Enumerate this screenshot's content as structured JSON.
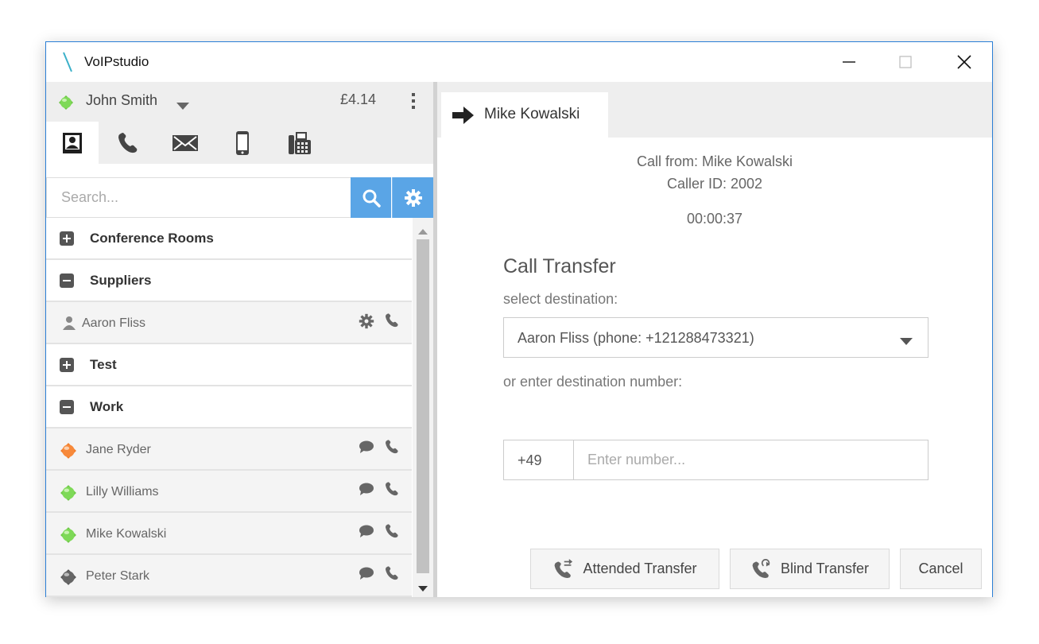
{
  "window": {
    "title": "VoIPstudio"
  },
  "account": {
    "name": "John Smith",
    "status": "online",
    "balance": "£4.14"
  },
  "search": {
    "placeholder": "Search..."
  },
  "contacts": {
    "groups": [
      {
        "label": "Conference Rooms",
        "expanded": false
      },
      {
        "label": "Suppliers",
        "expanded": true
      },
      {
        "label": "Test",
        "expanded": false
      },
      {
        "label": "Work",
        "expanded": true
      }
    ],
    "suppliers_contacts": [
      {
        "name": "Aaron Fliss"
      }
    ],
    "work_contacts": [
      {
        "name": "Jane Ryder",
        "status": "busy"
      },
      {
        "name": "Lilly Williams",
        "status": "online"
      },
      {
        "name": "Mike Kowalski",
        "status": "online"
      },
      {
        "name": "Peter Stark",
        "status": "offline"
      }
    ]
  },
  "colors": {
    "accent": "#5aa5e6",
    "online": "#6cc644",
    "busy": "#f07a24",
    "offline": "#666666",
    "logo": "#3bb0c9"
  },
  "call": {
    "tab_label": "Mike Kowalski",
    "from_line": "Call from: Mike Kowalski",
    "caller_id_line": "Caller ID: 2002",
    "duration": "00:00:37"
  },
  "transfer": {
    "title": "Call Transfer",
    "select_label": "select destination:",
    "selected_destination": "Aaron Fliss (phone: +121288473321)",
    "number_label": "or enter destination number:",
    "prefix": "+49",
    "number_placeholder": "Enter number...",
    "attended_label": "Attended Transfer",
    "blind_label": "Blind Transfer",
    "cancel_label": "Cancel"
  }
}
